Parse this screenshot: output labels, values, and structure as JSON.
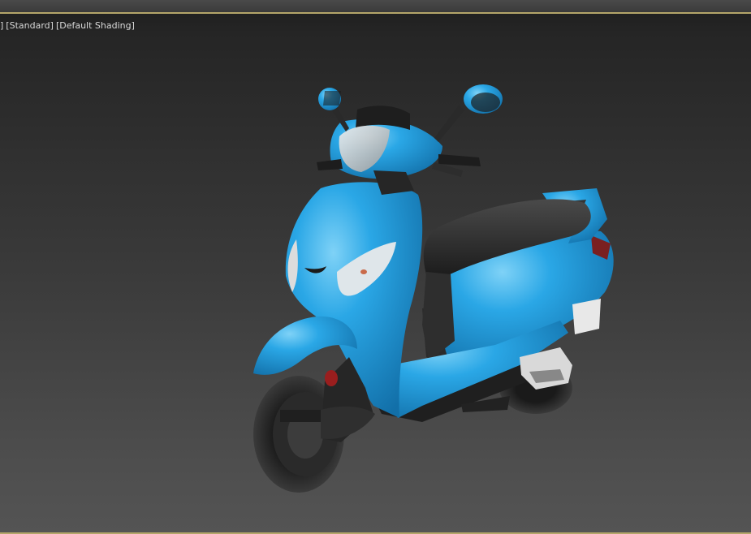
{
  "viewport": {
    "labels": [
      "]",
      "[Standard]",
      "[Default Shading]"
    ]
  },
  "scene": {
    "object": "scooter",
    "body_color": "#29a3e0",
    "seat_color": "#2a2a2a",
    "tire_color": "#222222"
  },
  "colors": {
    "background_top": "#1d1d1d",
    "background_bottom": "#545454",
    "frame_accent": "#b4a66a"
  }
}
